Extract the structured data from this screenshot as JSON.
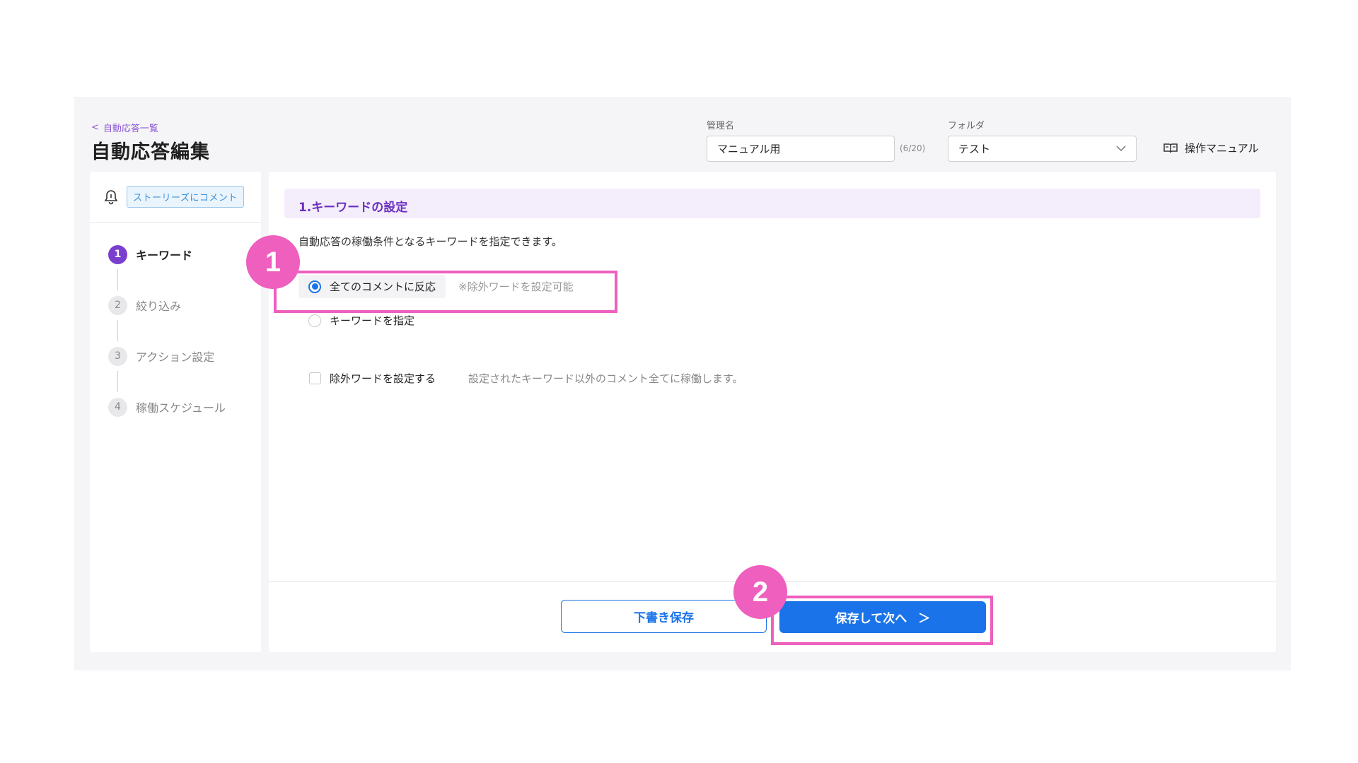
{
  "header": {
    "breadcrumb": "自動応答一覧",
    "title": "自動応答編集",
    "name_label": "管理名",
    "name_value": "マニュアル用",
    "name_counter": "(6/20)",
    "folder_label": "フォルダ",
    "folder_value": "テスト",
    "manual_link": "操作マニュアル"
  },
  "sidebar": {
    "badge": "ストーリーズにコメント",
    "steps": [
      {
        "num": "1",
        "label": "キーワード"
      },
      {
        "num": "2",
        "label": "絞り込み"
      },
      {
        "num": "3",
        "label": "アクション設定"
      },
      {
        "num": "4",
        "label": "稼働スケジュール"
      }
    ]
  },
  "main": {
    "section_title": "1.キーワードの設定",
    "description": "自動応答の稼働条件となるキーワードを指定できます。",
    "option_all": "全てのコメントに反応",
    "option_all_hint": "※除外ワードを設定可能",
    "option_keyword": "キーワードを指定",
    "exclude_label": "除外ワードを設定する",
    "exclude_desc": "設定されたキーワード以外のコメント全てに稼働します。",
    "draft_button": "下書き保存",
    "next_button": "保存して次へ",
    "next_chevron": "＞"
  },
  "annotations": {
    "marker1": "1",
    "marker2": "2",
    "color": "#ee5fbe"
  }
}
